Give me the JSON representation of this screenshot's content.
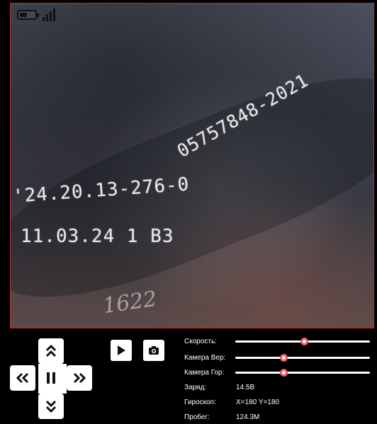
{
  "video_feed": {
    "marking_lines": [
      "24.20.13-276-05757848-2021",
      "'24.20.13-276-05757848-2021",
      "11.03.24  1  B3"
    ],
    "marking_top": "05757848-2021",
    "marking_mid": "'24.20.13-276-0",
    "marking_bottom": "11.03.24  1  B3",
    "scrawl": "1622"
  },
  "status": {
    "battery_level": 0.6,
    "signal_bars": 4
  },
  "controls": {
    "speed_label": "Скорость:",
    "speed_value": 0.51,
    "camera_vertical_label": "Камера Вер:",
    "camera_vertical_value": 0.36,
    "camera_horizontal_label": "Камера Гор:",
    "camera_horizontal_value": 0.36
  },
  "telemetry": {
    "charge_label": "Заряд:",
    "charge_value": "14.5В",
    "gyro_label": "Гироскоп:",
    "gyro_value": "X=180 Y=180",
    "distance_label": "Пробег:",
    "distance_value": "124.3М"
  },
  "colors": {
    "accent": "#ef5b63",
    "feed_border": "#c72b2b"
  },
  "icons": {
    "up": "double-chevron-up-icon",
    "down": "double-chevron-down-icon",
    "left": "double-chevron-left-icon",
    "right": "double-chevron-right-icon",
    "pause": "pause-icon",
    "play": "play-icon",
    "snapshot": "camera-icon"
  }
}
